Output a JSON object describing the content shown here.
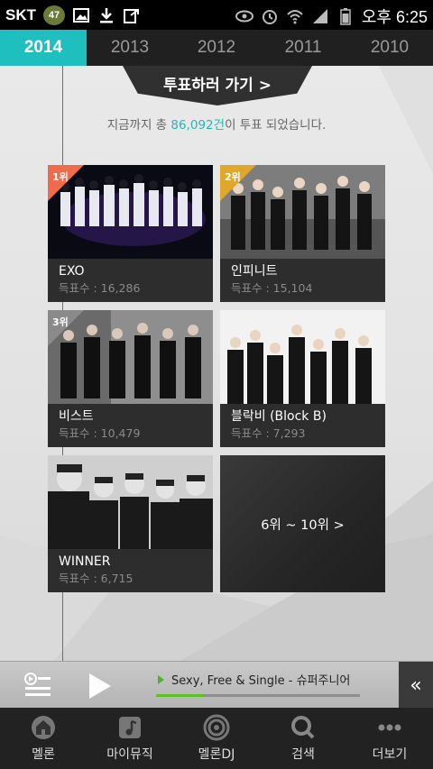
{
  "status_bar": {
    "carrier": "SKT",
    "badge": "47",
    "time": "오후 6:25"
  },
  "tabs": [
    {
      "label": "2014",
      "active": true
    },
    {
      "label": "2013",
      "active": false
    },
    {
      "label": "2012",
      "active": false
    },
    {
      "label": "2011",
      "active": false
    },
    {
      "label": "2010",
      "active": false
    }
  ],
  "vote": {
    "button_label": "투표하러 가기 >",
    "summary_prefix": "지금까지 총 ",
    "summary_count": "86,092건",
    "summary_suffix": "이 투표 되었습니다."
  },
  "rankings": [
    {
      "rank": "1위",
      "name": "EXO",
      "votes": "득표수 : 16,286",
      "rank_color": "#f06b4b"
    },
    {
      "rank": "2위",
      "name": "인피니트",
      "votes": "득표수 : 15,104",
      "rank_color": "#e0a82b"
    },
    {
      "rank": "3위",
      "name": "비스트",
      "votes": "득표수 : 10,479",
      "rank_color": "#8a8a8a"
    },
    {
      "rank": "",
      "name": "블락비 (Block B)",
      "votes": "득표수 : 7,293",
      "rank_color": ""
    },
    {
      "rank": "",
      "name": "WINNER",
      "votes": "득표수 : 6,715",
      "rank_color": ""
    }
  ],
  "more_button": "6위 ~ 10위 >",
  "player": {
    "track": "Sexy, Free & Single - 슈퍼주니어",
    "progress": 0.23,
    "collapse_icon": "«"
  },
  "bottom_nav": [
    {
      "label": "멜론",
      "icon": "home-icon"
    },
    {
      "label": "마이뮤직",
      "icon": "music-note-icon"
    },
    {
      "label": "멜론DJ",
      "icon": "headphones-icon"
    },
    {
      "label": "검색",
      "icon": "search-icon"
    },
    {
      "label": "더보기",
      "icon": "more-icon"
    }
  ],
  "colors": {
    "accent": "#1fbfbf",
    "count_highlight": "#22b9b5",
    "progress": "#5ac41e"
  }
}
